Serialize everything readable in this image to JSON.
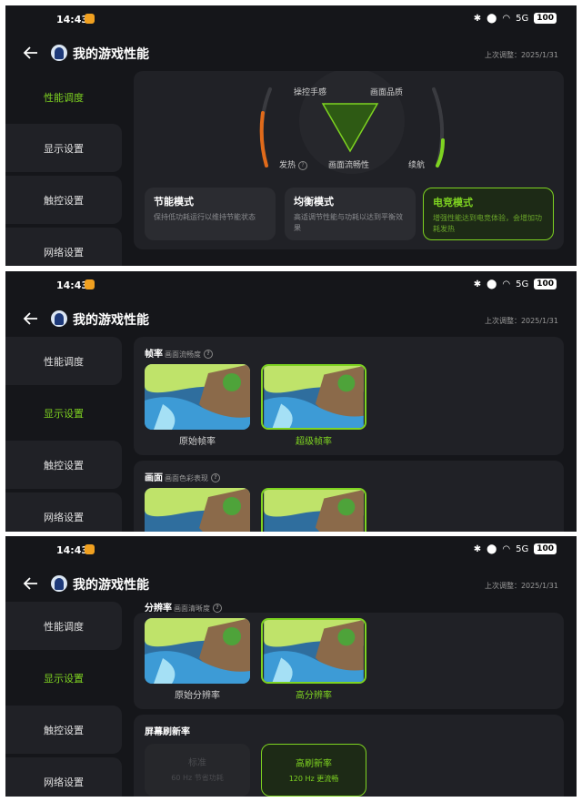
{
  "status": {
    "time": "14:43",
    "battery": "100",
    "net": "5G"
  },
  "header": {
    "title": "我的游戏性能",
    "last_adjust": "上次调整：2025/1/31"
  },
  "sidebar_items": [
    "性能调度",
    "显示设置",
    "触控设置",
    "网络设置"
  ],
  "performance": {
    "labels": {
      "control": "操控手感",
      "quality": "画面品质",
      "heat": "发热",
      "fluency": "画面流畅性",
      "endurance": "续航"
    },
    "modes": [
      {
        "title": "节能模式",
        "desc": "保持低功耗运行以维持节能状态"
      },
      {
        "title": "均衡模式",
        "desc": "高适调节性能与功耗以达到平衡效果"
      },
      {
        "title": "电竞模式",
        "desc": "增强性能达到电竞体验，会增加功耗发热"
      }
    ],
    "selected_mode": "电竞模式"
  },
  "display": {
    "frame_rate": {
      "title": "帧率",
      "subtitle": "画面流畅度",
      "options": [
        "原始帧率",
        "超级帧率"
      ],
      "selected": "超级帧率"
    },
    "picture": {
      "title": "画面",
      "subtitle": "画面色彩表现"
    },
    "resolution": {
      "title": "分辨率",
      "subtitle": "画面清晰度",
      "options": [
        "原始分辨率",
        "高分辨率"
      ],
      "selected": "高分辨率"
    },
    "refresh_rate": {
      "title": "屏幕刷新率",
      "options": [
        {
          "title": "标准",
          "desc": "60 Hz 节省功耗"
        },
        {
          "title": "高刷新率",
          "desc": "120 Hz 更流畅"
        }
      ],
      "selected": "高刷新率"
    }
  },
  "colors": {
    "accent": "#7ed321",
    "background": "#15161a",
    "card": "#202126"
  }
}
